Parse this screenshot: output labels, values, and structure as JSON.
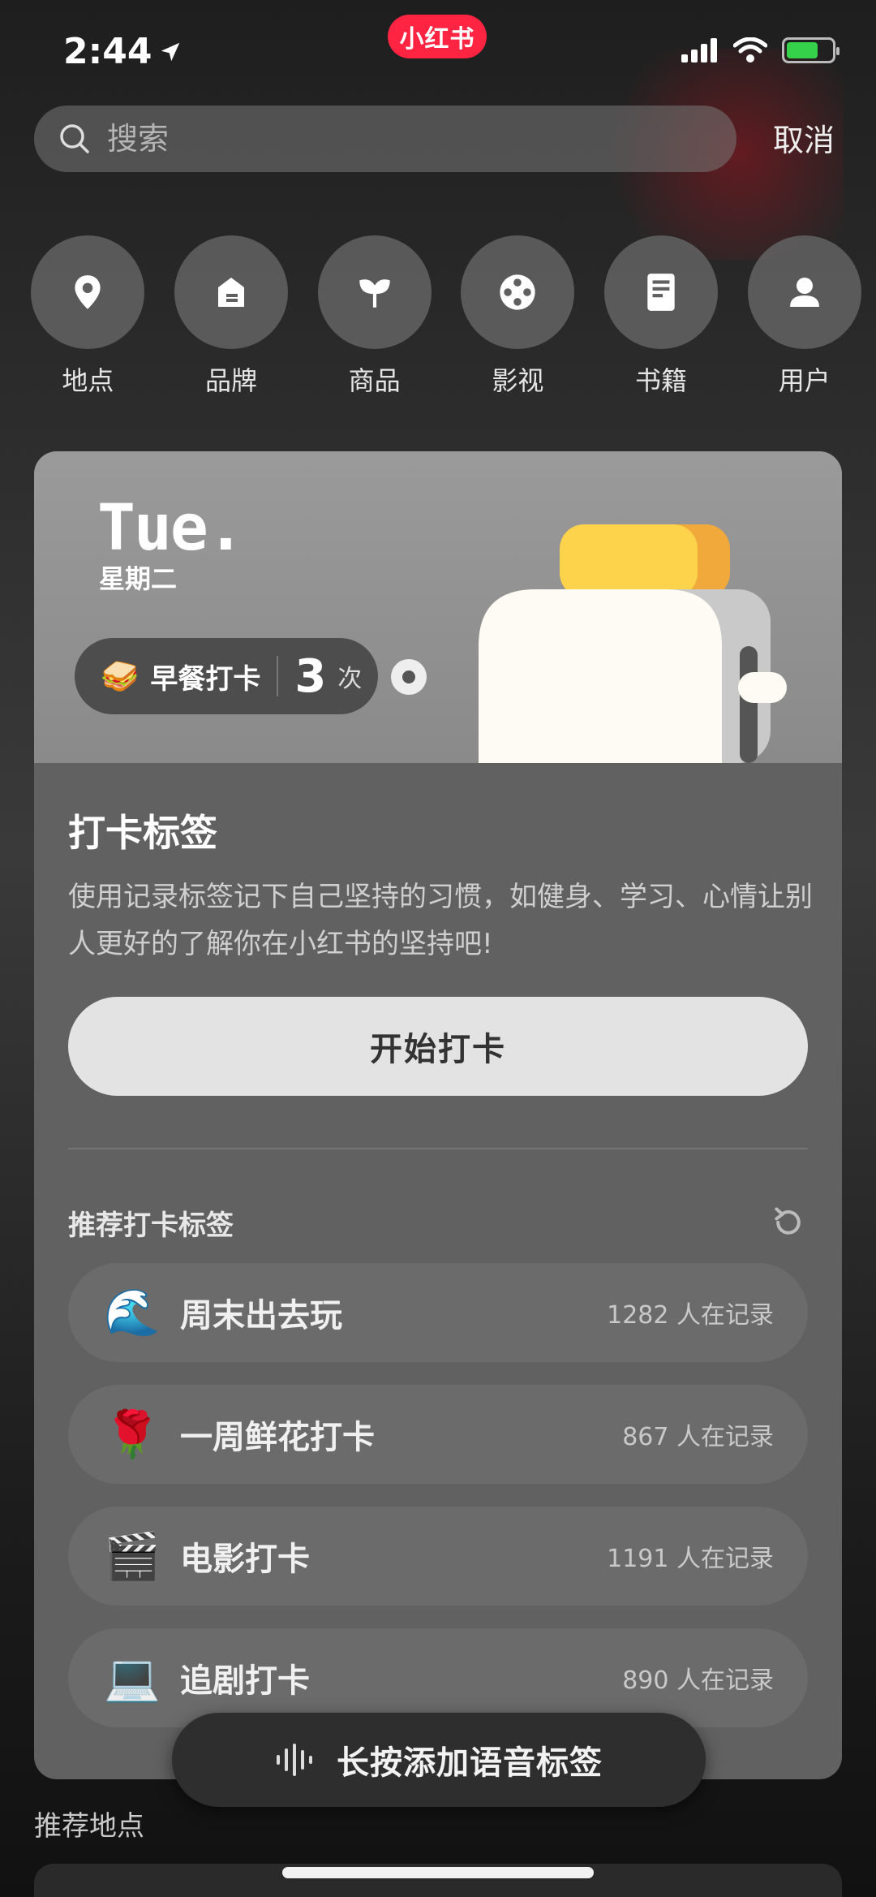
{
  "status_bar": {
    "time": "2:44",
    "app_badge": "小红书"
  },
  "search": {
    "placeholder": "搜索",
    "cancel_label": "取消"
  },
  "categories": [
    {
      "label": "地点",
      "icon": "location-pin-icon"
    },
    {
      "label": "品牌",
      "icon": "brand-tag-icon"
    },
    {
      "label": "商品",
      "icon": "product-icon"
    },
    {
      "label": "影视",
      "icon": "film-reel-icon"
    },
    {
      "label": "书籍",
      "icon": "book-icon"
    },
    {
      "label": "用户",
      "icon": "user-icon"
    }
  ],
  "card": {
    "day_short": "Tue.",
    "weekday": "星期二",
    "checkin": {
      "emoji": "🥪",
      "label": "早餐打卡",
      "count": "3",
      "unit": "次"
    },
    "section_title": "打卡标签",
    "description": "使用记录标签记下自己坚持的习惯，如健身、学习、心情让别人更好的了解你在小红书的坚持吧!",
    "start_button": "开始打卡",
    "recommended_title": "推荐打卡标签",
    "recommended": [
      {
        "emoji": "🌊",
        "label": "周末出去玩",
        "count": "1282 人在记录"
      },
      {
        "emoji": "🌹",
        "label": "一周鲜花打卡",
        "count": "867 人在记录"
      },
      {
        "emoji": "🎬",
        "label": "电影打卡",
        "count": "1191 人在记录"
      },
      {
        "emoji": "💻",
        "label": "追剧打卡",
        "count": "890 人在记录"
      }
    ]
  },
  "voice_bar": {
    "label": "长按添加语音标签"
  },
  "recommended_places_title": "推荐地点",
  "colors": {
    "brand": "#ff2442",
    "battery_green": "#35d14b",
    "card_bg": "#616161"
  }
}
